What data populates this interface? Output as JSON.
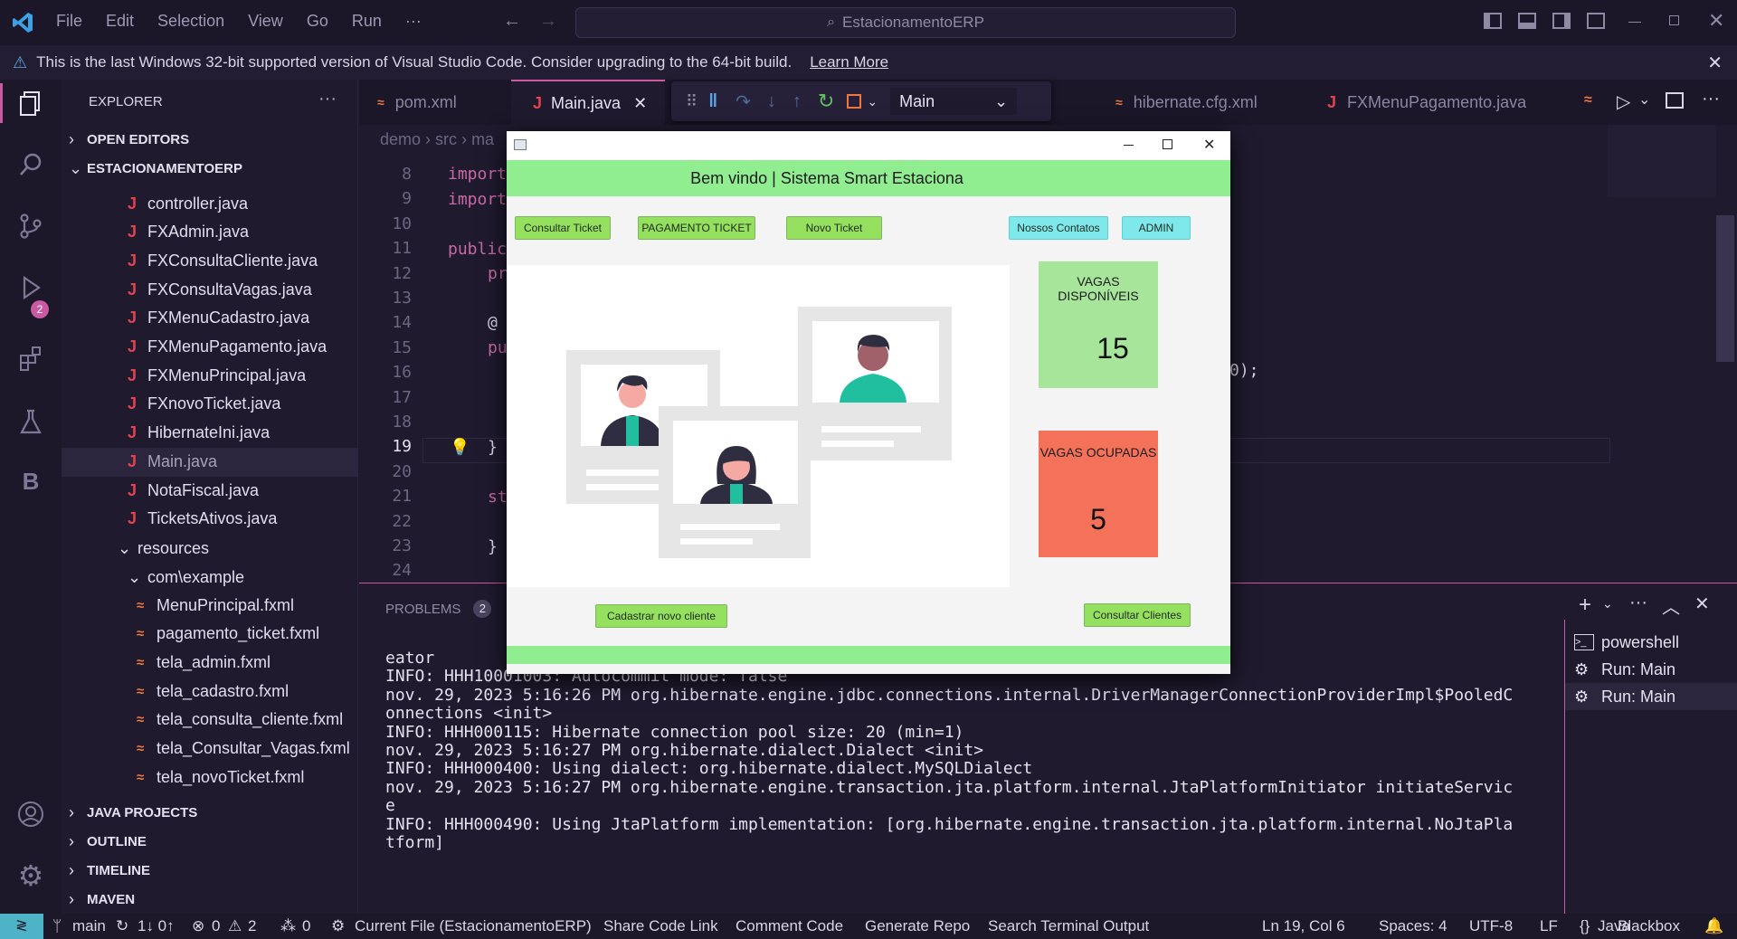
{
  "titlebar": {
    "menu": [
      "File",
      "Edit",
      "Selection",
      "View",
      "Go",
      "Run",
      "···"
    ],
    "search": "EstacionamentoERP"
  },
  "banner": {
    "message": "This is the last Windows 32-bit supported version of Visual Studio Code. Consider upgrading to the 64-bit build.",
    "link": "Learn More"
  },
  "activity": {
    "debug_badge": "2"
  },
  "sidebar": {
    "title": "EXPLORER",
    "open_editors": "OPEN EDITORS",
    "project": "ESTACIONAMENTOERP",
    "java_files": [
      "controller.java",
      "FXAdmin.java",
      "FXConsultaCliente.java",
      "FXConsultaVagas.java",
      "FXMenuCadastro.java",
      "FXMenuPagamento.java",
      "FXMenuPrincipal.java",
      "FXnovoTicket.java",
      "HibernateIni.java",
      "Main.java",
      "NotaFiscal.java",
      "TicketsAtivos.java"
    ],
    "resources": "resources",
    "package": "com\\example",
    "fxml_files": [
      "MenuPrincipal.fxml",
      "pagamento_ticket.fxml",
      "tela_admin.fxml",
      "tela_cadastro.fxml",
      "tela_consulta_cliente.fxml",
      "tela_Consultar_Vagas.fxml",
      "tela_novoTicket.fxml"
    ],
    "sections": [
      "JAVA PROJECTS",
      "OUTLINE",
      "TIMELINE",
      "MAVEN"
    ]
  },
  "tabs": {
    "pom": "pom.xml",
    "main": "Main.java",
    "hibernate": "hibernate.cfg.xml",
    "fxmenu": "FXMenuPagamento.java",
    "debug_target": "Main"
  },
  "editor": {
    "breadcrumb": [
      "demo",
      "src",
      "ma"
    ],
    "line_numbers": [
      "8",
      "9",
      "10",
      "11",
      "12",
      "13",
      "14",
      "15",
      "16",
      "17",
      "18",
      "19",
      "20",
      "21",
      "22",
      "23",
      "24"
    ],
    "code": {
      "l8": "import",
      "l9": "import",
      "l11": "public",
      "l12": "pr",
      "l14": "@",
      "l15": "pu",
      "l19": "}",
      "l21": "st",
      "l23": "}",
      "tail": "0);"
    }
  },
  "panel": {
    "problems_label": "PROBLEMS",
    "problems_count": "2",
    "terminal_lines": [
      "eator",
      "INFO: HHH10001003: Autocommit mode: false",
      "nov. 29, 2023 5:16:26 PM org.hibernate.engine.jdbc.connections.internal.DriverManagerConnectionProviderImpl$PooledC",
      "onnections <init>",
      "INFO: HHH000115: Hibernate connection pool size: 20 (min=1)",
      "nov. 29, 2023 5:16:27 PM org.hibernate.dialect.Dialect <init>",
      "INFO: HHH000400: Using dialect: org.hibernate.dialect.MySQLDialect",
      "nov. 29, 2023 5:16:27 PM org.hibernate.engine.transaction.jta.platform.internal.JtaPlatformInitiator initiateServic",
      "e",
      "INFO: HHH000490: Using JtaPlatform implementation: [org.hibernate.engine.transaction.jta.platform.internal.NoJtaPla",
      "tform]"
    ],
    "terminals": [
      "powershell",
      "Run: Main",
      "Run: Main"
    ]
  },
  "status": {
    "branch": "main",
    "sync": "1↓ 0↑",
    "errors": "0",
    "warnings": "2",
    "ports": "0",
    "current_file": "Current File (EstacionamentoERP)",
    "share": "Share Code Link",
    "comment": "Comment Code",
    "generate": "Generate Repo",
    "search_terminal": "Search Terminal Output",
    "position": "Ln 19, Col 6",
    "spaces": "Spaces: 4",
    "encoding": "UTF-8",
    "eol": "LF",
    "language": "Java",
    "blackbox": "Blackbox"
  },
  "app": {
    "header": "Bem vindo | Sistema Smart Estaciona",
    "buttons": {
      "consultar_ticket": "Consultar Ticket",
      "pagamento": "PAGAMENTO TICKET",
      "novo_ticket": "Novo Ticket",
      "contatos": "Nossos Contatos",
      "admin": "ADMIN",
      "cadastrar": "Cadastrar novo cliente",
      "consultar_clientes": "Consultar Clientes"
    },
    "vagas_disponiveis_label": "VAGAS DISPONÍVEIS",
    "vagas_disponiveis": "15",
    "vagas_ocupadas_label": "VAGAS OCUPADAS",
    "vagas_ocupadas": "5"
  },
  "colors": {
    "accent_green": "#90ee90",
    "button_green": "#95e05f",
    "button_cyan": "#7ee8ea",
    "free_box": "#a6e59a",
    "occupied_box": "#f4715a",
    "figure_teal": "#1fbfa0"
  }
}
